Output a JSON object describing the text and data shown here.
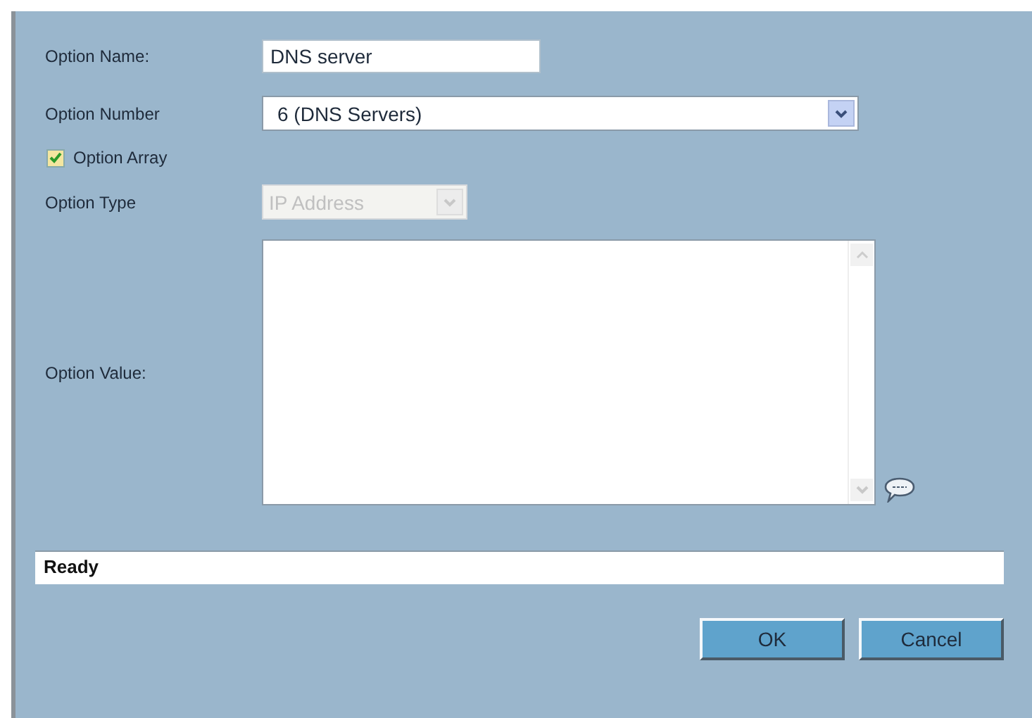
{
  "option_name": {
    "label": "Option Name:",
    "value": "DNS server"
  },
  "option_number": {
    "label": "Option Number",
    "value": "6 (DNS Servers)"
  },
  "option_array": {
    "label": "Option Array",
    "checked": true
  },
  "option_type": {
    "label": "Option Type",
    "value": "IP Address",
    "disabled": true
  },
  "option_value": {
    "label": "Option Value:"
  },
  "status_bar": "Ready",
  "buttons": [
    "OK",
    "Cancel"
  ]
}
